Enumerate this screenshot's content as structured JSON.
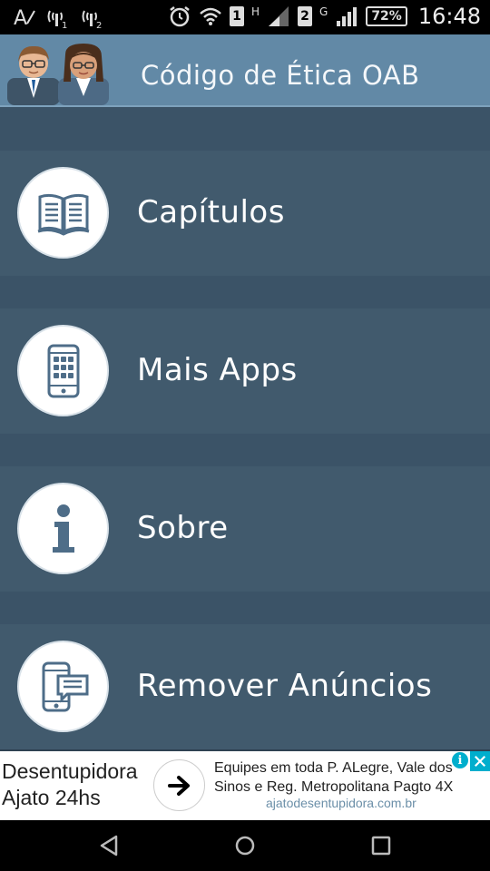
{
  "status_bar": {
    "icons_left": [
      "text-size-icon",
      "signal-sim1-icon",
      "signal-sim2-icon"
    ],
    "alarm_icon": "alarm-icon",
    "wifi_icon": "wifi-icon",
    "sim1_label": "1",
    "network_type_1": "H",
    "sim2_label": "2",
    "network_type_2": "G",
    "battery": "72%",
    "time": "16:48"
  },
  "app_bar": {
    "title": "Código de Ética OAB",
    "logo_icon": "lawyers-logo-icon"
  },
  "menu": {
    "items": [
      {
        "label": "Capítulos",
        "icon": "book-icon"
      },
      {
        "label": "Mais Apps",
        "icon": "phone-apps-icon"
      },
      {
        "label": "Sobre",
        "icon": "info-icon"
      },
      {
        "label": "Remover Anúncios",
        "icon": "phone-message-icon"
      }
    ]
  },
  "ad": {
    "left_line1": "Desentupidora",
    "left_line2": "Ajato 24hs",
    "text": "Equipes em toda P. ALegre, Vale dos Sinos e Reg. Metropolitana Pagto 4X",
    "url": "ajatodesentupidora.com.br",
    "info_label": "i"
  },
  "nav_bar": {
    "back": "back-icon",
    "home": "home-icon",
    "recents": "recents-icon"
  },
  "colors": {
    "app_bar": "#6289a6",
    "menu_item": "#415a6d",
    "menu_gap": "#3b5367",
    "icon_fill": "#4e6d88",
    "ad_accent": "#00aecd"
  }
}
